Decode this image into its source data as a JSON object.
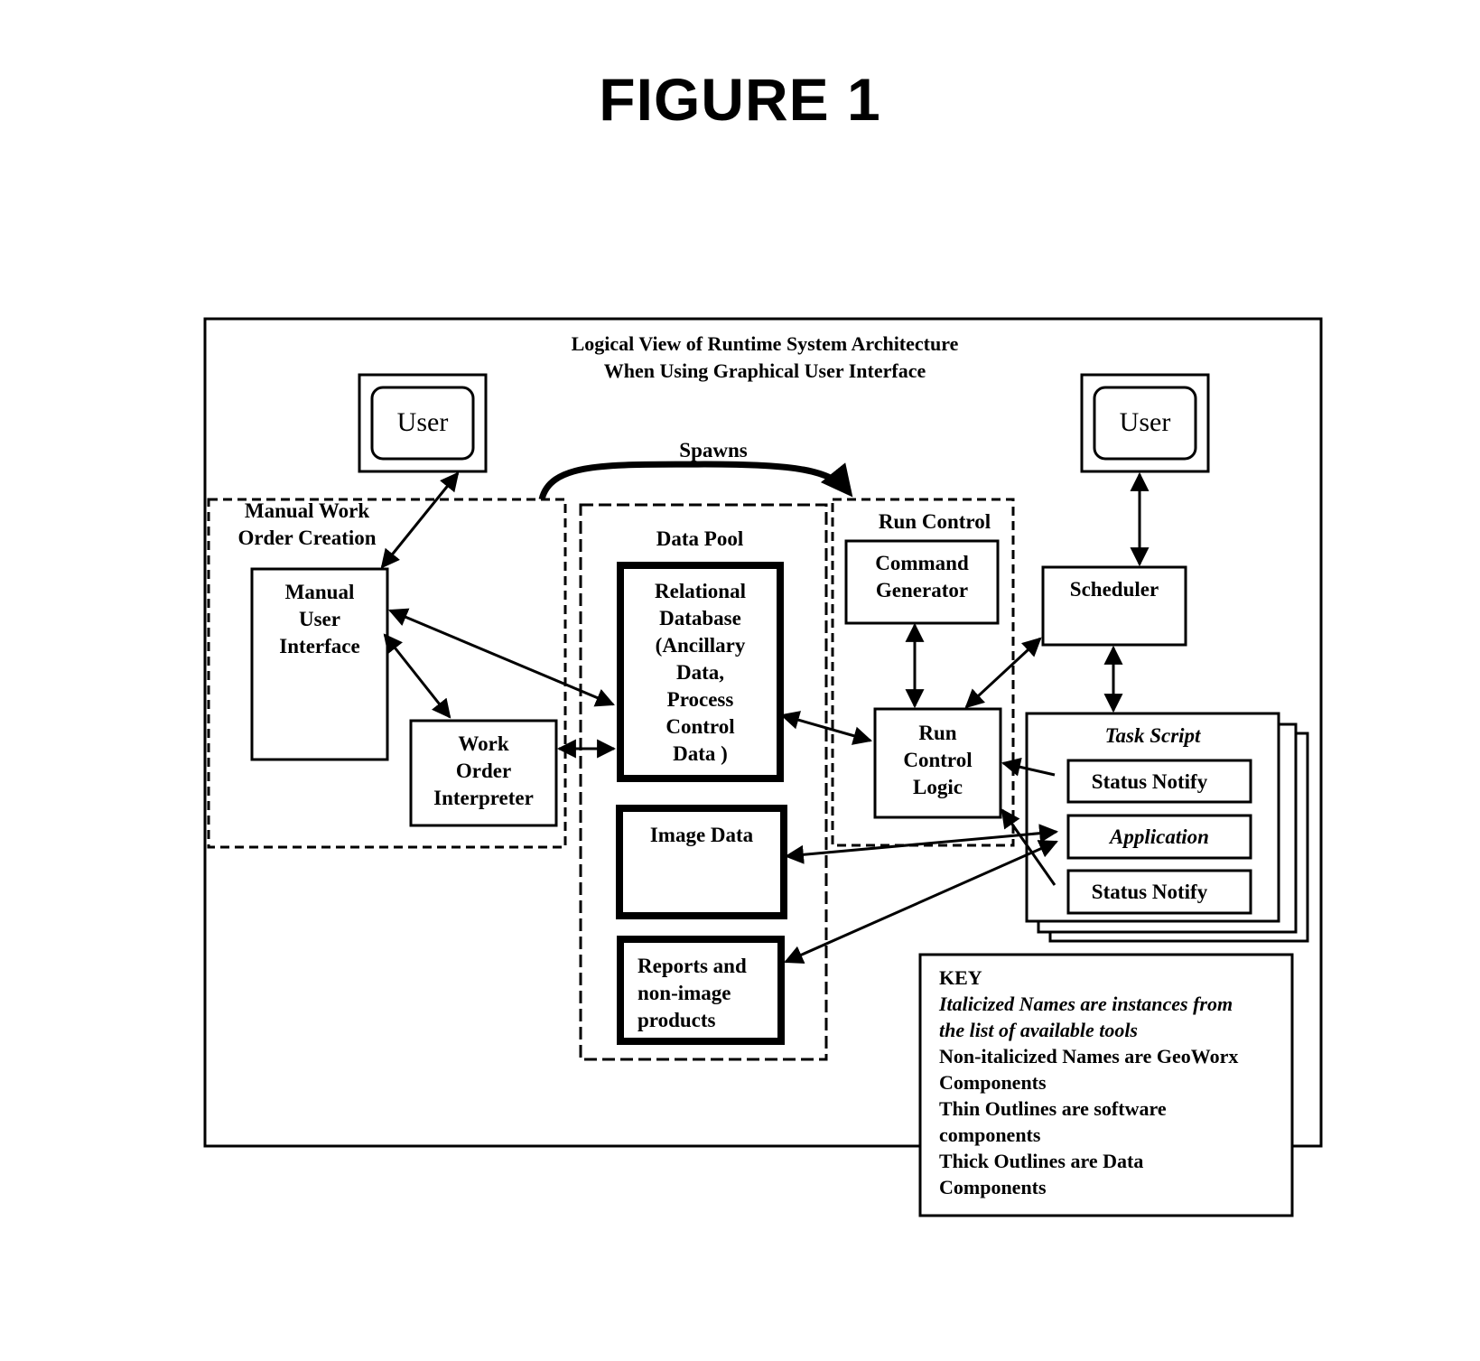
{
  "figure": {
    "title": "FIGURE 1",
    "diagram_title_line1": "Logical View of Runtime System Architecture",
    "diagram_title_line2": "When Using Graphical User Interface"
  },
  "labels": {
    "user_left": "User",
    "user_right": "User",
    "spawns": "Spawns",
    "manual_work_order_creation_1": "Manual Work",
    "manual_work_order_creation_2": "Order Creation",
    "manual_user_interface": [
      "Manual",
      "User",
      "Interface"
    ],
    "work_order_interpreter": [
      "Work",
      "Order",
      "Interpreter"
    ],
    "data_pool": "Data Pool",
    "relational_database": [
      "Relational",
      "Database",
      "(Ancillary",
      "Data,",
      "Process",
      "Control",
      "Data )"
    ],
    "image_data": "Image Data",
    "reports": [
      "Reports and",
      "non-image",
      "products"
    ],
    "run_control": "Run Control",
    "command_generator": [
      "Command",
      "Generator"
    ],
    "run_control_logic": [
      "Run",
      "Control",
      "Logic"
    ],
    "scheduler": "Scheduler",
    "task_script": "Task Script",
    "status_notify_1": "Status Notify",
    "application": "Application",
    "status_notify_2": "Status Notify"
  },
  "key": {
    "heading": "KEY",
    "lines": [
      {
        "text": "Italicized Names are instances from",
        "italic": true
      },
      {
        "text": "the list of available tools",
        "italic": true
      },
      {
        "text": "Non-italicized Names are GeoWorx",
        "italic": false
      },
      {
        "text": "Components",
        "italic": false
      },
      {
        "text": "Thin Outlines are software",
        "italic": false
      },
      {
        "text": "components",
        "italic": false
      },
      {
        "text": "Thick Outlines are Data",
        "italic": false
      },
      {
        "text": "Components",
        "italic": false
      }
    ]
  },
  "connections": [
    {
      "from": "User (left)",
      "to": "Manual User Interface",
      "type": "bidirectional"
    },
    {
      "from": "Manual User Interface",
      "to": "Relational Database",
      "type": "bidirectional"
    },
    {
      "from": "Manual User Interface",
      "to": "Work Order Interpreter",
      "type": "bidirectional"
    },
    {
      "from": "Work Order Interpreter",
      "to": "Relational Database",
      "type": "bidirectional"
    },
    {
      "from": "Manual Work Order Creation",
      "to": "Run Control",
      "type": "spawns"
    },
    {
      "from": "Relational Database",
      "to": "Run Control Logic",
      "type": "bidirectional"
    },
    {
      "from": "Command Generator",
      "to": "Run Control Logic",
      "type": "bidirectional"
    },
    {
      "from": "Scheduler",
      "to": "Run Control Logic",
      "type": "bidirectional"
    },
    {
      "from": "User (right)",
      "to": "Scheduler",
      "type": "bidirectional"
    },
    {
      "from": "Scheduler",
      "to": "Task Script",
      "type": "bidirectional"
    },
    {
      "from": "Status Notify",
      "to": "Run Control Logic",
      "type": "directed"
    },
    {
      "from": "Image Data",
      "to": "Application",
      "type": "bidirectional"
    },
    {
      "from": "Application",
      "to": "Reports and non-image products",
      "type": "bidirectional"
    }
  ]
}
